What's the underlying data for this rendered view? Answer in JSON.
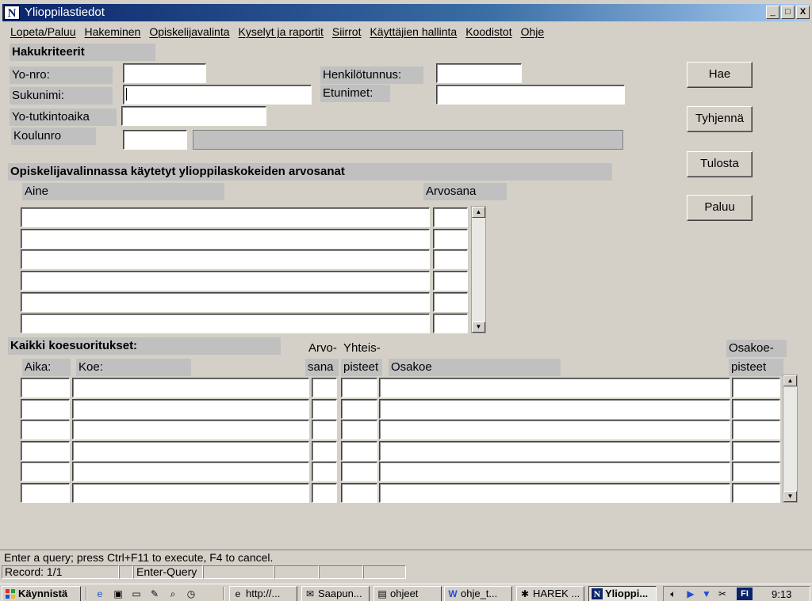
{
  "window": {
    "title": "Ylioppilastiedot",
    "icon_letter": "N",
    "minimize": "_",
    "maximize": "□",
    "close": "X"
  },
  "menu": [
    "Lopeta/Paluu",
    "Hakeminen",
    "Opiskelijavalinta",
    "Kyselyt ja raportit",
    "Siirrot",
    "Käyttäjien hallinta",
    "Koodistot",
    "Ohje"
  ],
  "search": {
    "header": "Hakukriteerit",
    "yo_nro": "Yo-nro:",
    "henkilotunnus": "Henkilötunnus:",
    "sukunimi": "Sukunimi:",
    "etunimet": "Etunimet:",
    "yo_tutkintoaika": "Yo-tutkintoaika",
    "koulunro": "Koulunro"
  },
  "buttons": {
    "hae": "Hae",
    "tyhjenna": "Tyhjennä",
    "tulosta": "Tulosta",
    "paluu": "Paluu"
  },
  "grades": {
    "header": "Opiskelijavalinnassa käytetyt ylioppilaskokeiden arvosanat",
    "col_aine": "Aine",
    "col_arvosana": "Arvosana",
    "row_count": 6
  },
  "exams": {
    "header": "Kaikki koesuoritukset:",
    "col_aika": "Aika:",
    "col_koe": "Koe:",
    "col_arvosana_1": "Arvo-",
    "col_arvosana_2": "sana",
    "col_yhteis_1": "Yhteis-",
    "col_yhteis_2": "pisteet",
    "col_osakoe": "Osakoe",
    "col_osakoe_pisteet_1": "Osakoe-",
    "col_osakoe_pisteet_2": "pisteet",
    "row_count": 6
  },
  "status": {
    "message": "Enter a query;  press Ctrl+F11 to execute, F4 to cancel.",
    "record": "Record: 1/1",
    "mode": "Enter-Query"
  },
  "taskbar": {
    "start": "Käynnistä",
    "tasks": [
      "http://...",
      "Saapun...",
      "ohjeet",
      "ohje_t...",
      "HAREK ...",
      "Ylioppi..."
    ],
    "lang": "FI",
    "clock": "9:13"
  }
}
